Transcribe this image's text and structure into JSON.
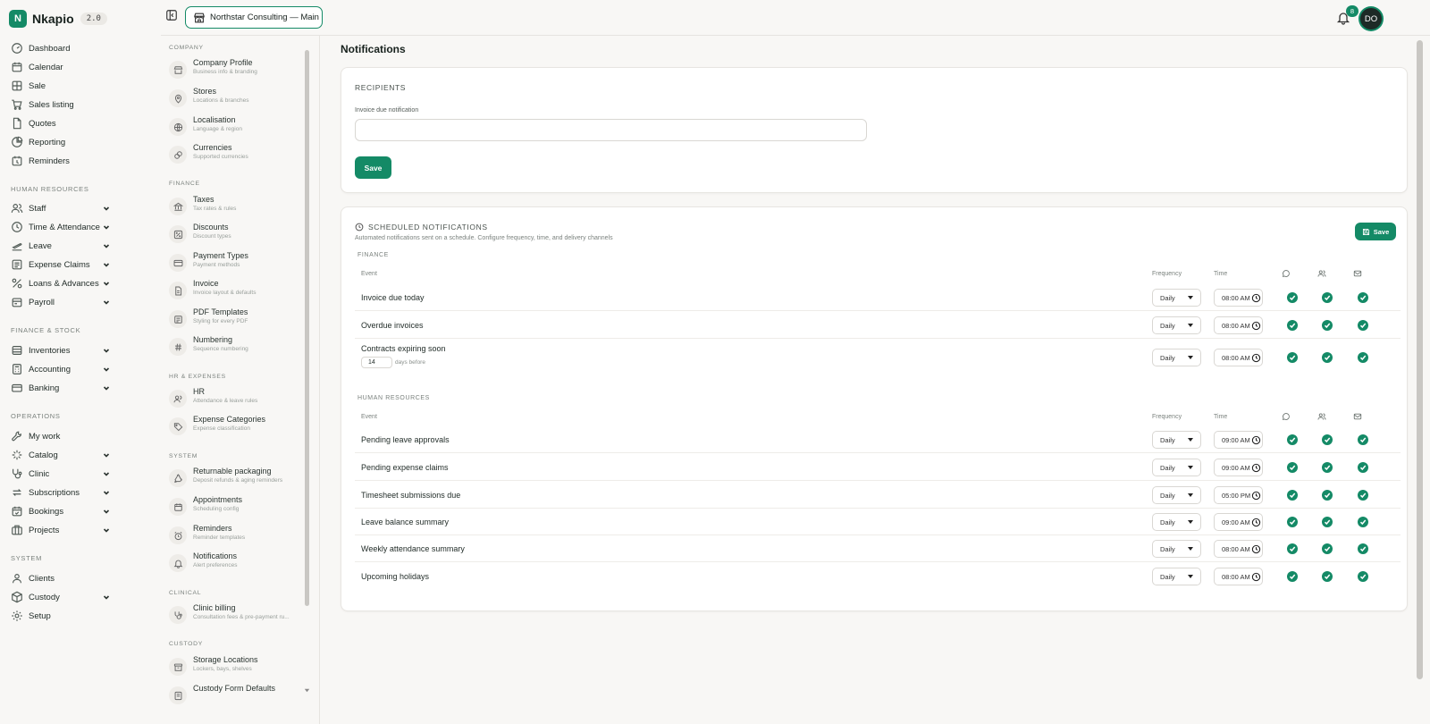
{
  "brand": {
    "logo_letter": "N",
    "name": "Nkapio",
    "version": "2.0"
  },
  "colors": {
    "accent": "#148a66",
    "background": "#f8f7f5"
  },
  "nav": {
    "main": [
      {
        "label": "Dashboard",
        "icon": "dashboard-icon"
      },
      {
        "label": "Calendar",
        "icon": "calendar-icon"
      },
      {
        "label": "Sale",
        "icon": "grid-icon"
      },
      {
        "label": "Sales listing",
        "icon": "cart-icon"
      },
      {
        "label": "Quotes",
        "icon": "file-icon"
      },
      {
        "label": "Reporting",
        "icon": "pie-chart-icon"
      },
      {
        "label": "Reminders",
        "icon": "reminder-icon"
      }
    ],
    "hr_title": "HUMAN RESOURCES",
    "hr": [
      {
        "label": "Staff",
        "icon": "users-icon"
      },
      {
        "label": "Time & Attendance",
        "icon": "clock-icon"
      },
      {
        "label": "Leave",
        "icon": "plane-icon"
      },
      {
        "label": "Expense Claims",
        "icon": "receipt-icon"
      },
      {
        "label": "Loans & Advances",
        "icon": "loans-icon"
      },
      {
        "label": "Payroll",
        "icon": "payroll-icon"
      }
    ],
    "fin_title": "FINANCE & STOCK",
    "fin": [
      {
        "label": "Inventories",
        "icon": "inventory-icon"
      },
      {
        "label": "Accounting",
        "icon": "accounting-icon"
      },
      {
        "label": "Banking",
        "icon": "bank-icon"
      }
    ],
    "ops_title": "OPERATIONS",
    "ops": [
      {
        "label": "My work",
        "icon": "wrench-icon"
      },
      {
        "label": "Catalog",
        "icon": "catalog-icon"
      },
      {
        "label": "Clinic",
        "icon": "stethoscope-icon"
      },
      {
        "label": "Subscriptions",
        "icon": "refresh-icon"
      },
      {
        "label": "Bookings",
        "icon": "bookings-icon"
      },
      {
        "label": "Projects",
        "icon": "projects-icon"
      }
    ],
    "sys_title": "SYSTEM",
    "sys": [
      {
        "label": "Clients",
        "icon": "user-icon"
      },
      {
        "label": "Custody",
        "icon": "box-icon"
      },
      {
        "label": "Setup",
        "icon": "gear-icon"
      }
    ]
  },
  "settings": {
    "company_title": "COMPANY",
    "company": [
      {
        "title": "Company Profile",
        "sub": "Business info & branding",
        "icon": "building-icon"
      },
      {
        "title": "Stores",
        "sub": "Locations & branches",
        "icon": "pin-icon"
      },
      {
        "title": "Localisation",
        "sub": "Language & region",
        "icon": "globe-icon"
      },
      {
        "title": "Currencies",
        "sub": "Supported currencies",
        "icon": "coins-icon"
      }
    ],
    "finance_title": "FINANCE",
    "finance": [
      {
        "title": "Taxes",
        "sub": "Tax rates & rules",
        "icon": "landmark-icon"
      },
      {
        "title": "Discounts",
        "sub": "Discount types",
        "icon": "discount-icon"
      },
      {
        "title": "Payment Types",
        "sub": "Payment methods",
        "icon": "card-icon"
      },
      {
        "title": "Invoice",
        "sub": "Invoice layout & defaults",
        "icon": "invoice-icon"
      },
      {
        "title": "PDF Templates",
        "sub": "Styling for every PDF",
        "icon": "pdf-icon"
      },
      {
        "title": "Numbering",
        "sub": "Sequence numbering",
        "icon": "hash-icon"
      }
    ],
    "hr_title": "HR & EXPENSES",
    "hr": [
      {
        "title": "HR",
        "sub": "Attendance & leave rules",
        "icon": "users-icon"
      },
      {
        "title": "Expense Categories",
        "sub": "Expense classification",
        "icon": "tag-icon"
      }
    ],
    "system_title": "SYSTEM",
    "system": [
      {
        "title": "Returnable packaging",
        "sub": "Deposit refunds & aging reminders",
        "icon": "recycle-icon"
      },
      {
        "title": "Appointments",
        "sub": "Scheduling config",
        "icon": "calendar-icon"
      },
      {
        "title": "Reminders",
        "sub": "Reminder templates",
        "icon": "alarm-icon"
      },
      {
        "title": "Notifications",
        "sub": "Alert preferences",
        "icon": "bell-icon"
      }
    ],
    "clinical_title": "CLINICAL",
    "clinical": [
      {
        "title": "Clinic billing",
        "sub": "Consultation fees & pre-payment ru...",
        "icon": "stethoscope-icon"
      }
    ],
    "custody_title": "CUSTODY",
    "custody": [
      {
        "title": "Storage Locations",
        "sub": "Lockers, bays, shelves",
        "icon": "archive-icon"
      },
      {
        "title": "Custody Form Defaults",
        "sub": "",
        "icon": "form-icon"
      }
    ]
  },
  "topbar": {
    "workspace": "Northstar Consulting — Main",
    "notification_count": "8",
    "avatar_initials": "DO"
  },
  "page": {
    "title": "Notifications"
  },
  "recipients": {
    "heading": "RECIPIENTS",
    "field_label": "Invoice due notification",
    "field_value": "",
    "field_placeholder": "",
    "save_label": "Save"
  },
  "scheduled": {
    "heading": "SCHEDULED NOTIFICATIONS",
    "description": "Automated notifications sent on a schedule. Configure frequency, time, and delivery channels",
    "save_label": "Save",
    "columns": {
      "event": "Event",
      "frequency": "Frequency",
      "time": "Time",
      "channel_icons": [
        "chat-icon",
        "user-group-icon",
        "mail-icon"
      ]
    },
    "groups": [
      {
        "title": "FINANCE",
        "rows": [
          {
            "event": "Invoice due today",
            "frequency": "Daily",
            "time": "08:00 AM",
            "channels": [
              true,
              true,
              true
            ]
          },
          {
            "event": "Overdue invoices",
            "frequency": "Daily",
            "time": "08:00 AM",
            "channels": [
              true,
              true,
              true
            ]
          },
          {
            "event": "Contracts expiring soon",
            "frequency": "Daily",
            "time": "08:00 AM",
            "days_value": "14",
            "days_label": "days before",
            "channels": [
              true,
              true,
              true
            ]
          }
        ]
      },
      {
        "title": "HUMAN RESOURCES",
        "rows": [
          {
            "event": "Pending leave approvals",
            "frequency": "Daily",
            "time": "09:00 AM",
            "channels": [
              true,
              true,
              true
            ]
          },
          {
            "event": "Pending expense claims",
            "frequency": "Daily",
            "time": "09:00 AM",
            "channels": [
              true,
              true,
              true
            ]
          },
          {
            "event": "Timesheet submissions due",
            "frequency": "Daily",
            "time": "05:00 PM",
            "channels": [
              true,
              true,
              true
            ]
          },
          {
            "event": "Leave balance summary",
            "frequency": "Daily",
            "time": "09:00 AM",
            "channels": [
              true,
              true,
              true
            ]
          },
          {
            "event": "Weekly attendance summary",
            "frequency": "Daily",
            "time": "08:00 AM",
            "channels": [
              true,
              true,
              true
            ]
          },
          {
            "event": "Upcoming holidays",
            "frequency": "Daily",
            "time": "08:00 AM",
            "channels": [
              true,
              true,
              true
            ]
          }
        ]
      }
    ]
  }
}
